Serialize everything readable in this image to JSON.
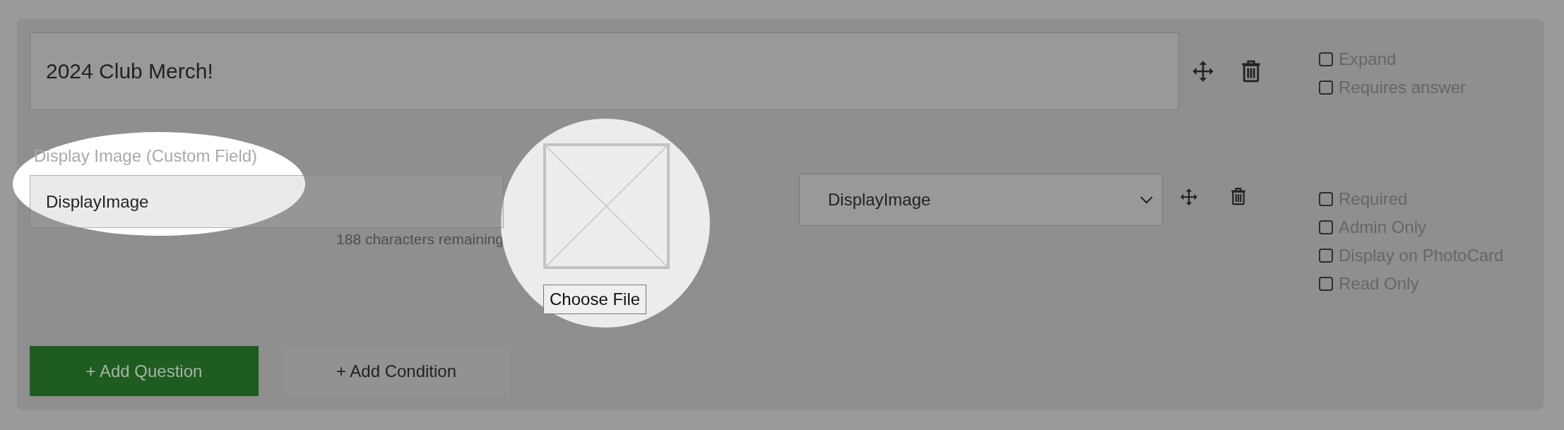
{
  "question": {
    "title": "2024 Club Merch!",
    "options": [
      {
        "label": "Expand",
        "checked": false
      },
      {
        "label": "Requires answer",
        "checked": false
      }
    ]
  },
  "custom_field": {
    "label": "Display Image (Custom Field)",
    "value": "DisplayImage",
    "remaining": "188 characters remaining",
    "file_button": "Choose File",
    "select_value": "DisplayImage",
    "options": [
      {
        "label": "Required",
        "checked": false
      },
      {
        "label": "Admin Only",
        "checked": false
      },
      {
        "label": "Display on PhotoCard",
        "checked": false
      },
      {
        "label": "Read Only",
        "checked": false
      }
    ]
  },
  "buttons": [
    {
      "label": "+ Add Question",
      "kind": "primary"
    },
    {
      "label": "+ Add Condition",
      "kind": "secondary"
    }
  ]
}
